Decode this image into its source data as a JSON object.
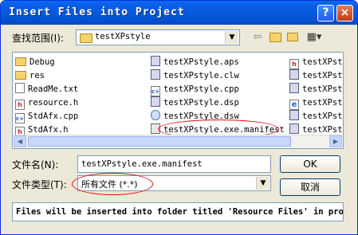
{
  "window": {
    "title": "Insert Files into Project",
    "help_button": "?",
    "close_button": "×"
  },
  "lookin": {
    "label": "查找范围(I):",
    "value": "testXPstyle"
  },
  "toolbar_icons": [
    "back-arrow-icon",
    "up-folder-icon",
    "new-folder-icon",
    "view-menu-icon"
  ],
  "files": {
    "col1": [
      {
        "name": "Debug",
        "icon": "folder-icon"
      },
      {
        "name": "res",
        "icon": "folder-icon"
      },
      {
        "name": "ReadMe.txt",
        "icon": "text-file-icon"
      },
      {
        "name": "resource.h",
        "icon": "header-file-icon"
      },
      {
        "name": "StdAfx.cpp",
        "icon": "cpp-file-icon"
      },
      {
        "name": "StdAfx.h",
        "icon": "header-file-icon"
      }
    ],
    "col2": [
      {
        "name": "testXPstyle.aps",
        "icon": "project-file-icon"
      },
      {
        "name": "testXPstyle.clw",
        "icon": "project-file-icon"
      },
      {
        "name": "testXPstyle.cpp",
        "icon": "cpp-file-icon"
      },
      {
        "name": "testXPstyle.dsp",
        "icon": "project-file-icon"
      },
      {
        "name": "testXPstyle.dsw",
        "icon": "workspace-file-icon"
      },
      {
        "name": "testXPstyle.exe.manifest",
        "icon": "manifest-file-icon"
      }
    ],
    "col3": [
      {
        "name": "testXPsty",
        "icon": "header-file-icon"
      },
      {
        "name": "testXPsty",
        "icon": "project-file-icon"
      },
      {
        "name": "testXPsty",
        "icon": "project-file-icon"
      },
      {
        "name": "testXPsty",
        "icon": "ie-file-icon"
      },
      {
        "name": "testXPsty",
        "icon": "project-file-icon"
      },
      {
        "name": "testXPsty",
        "icon": "project-file-icon"
      }
    ]
  },
  "filename": {
    "label": "文件名(N):",
    "value": "testXPstyle.exe.manifest"
  },
  "filetype": {
    "label": "文件类型(T):",
    "value": "所有文件 (*.*)"
  },
  "buttons": {
    "ok": "OK",
    "cancel": "取消"
  },
  "status": "Files will be inserted into folder titled 'Resource Files' in project",
  "colors": {
    "titlebar": "#0458d8",
    "annotation": "#e01010",
    "dialog_bg": "#ece9d8"
  }
}
